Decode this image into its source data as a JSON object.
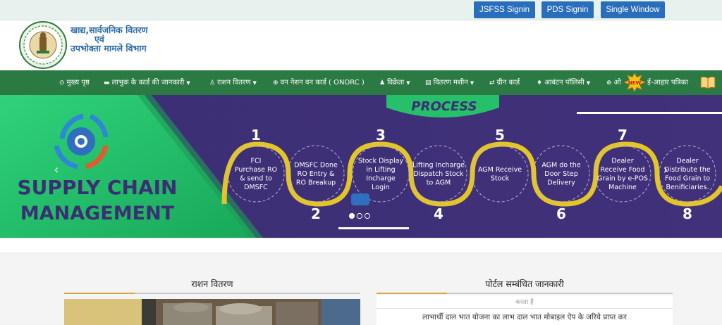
{
  "top_buttons": [
    {
      "label": "JSFSS Signin"
    },
    {
      "label": "PDS Signin"
    },
    {
      "label": "Single Window"
    }
  ],
  "header": {
    "dept_line1": "खाद्य,सार्वजनिक  वितरण",
    "dept_line2": "एवं",
    "dept_line3": "उपभोक्ता  मामले  विभाग"
  },
  "nav": {
    "items": [
      {
        "label": "मुख्य पृष्ठ",
        "icon": "home-icon",
        "dropdown": false
      },
      {
        "label": "लाभुक के कार्ड की जानकारी",
        "icon": "card-icon",
        "dropdown": true
      },
      {
        "label": "राशन वितरण",
        "icon": "user-icon",
        "dropdown": true
      },
      {
        "label": "वन नेशन वन कार्ड ( ONORC )",
        "icon": "globe-icon",
        "dropdown": false
      },
      {
        "label": "विक्रेता",
        "icon": "person-icon",
        "dropdown": true
      },
      {
        "label": "वितरण मशीन",
        "icon": "book-icon",
        "dropdown": true
      },
      {
        "label": "ग्रीन कार्ड",
        "icon": "shuffle-icon",
        "dropdown": false
      },
      {
        "label": "आबंटन पॉलिसी",
        "icon": "drop-icon",
        "dropdown": true
      },
      {
        "label": "ओ",
        "icon": "globe-icon",
        "dropdown": false
      },
      {
        "label": "ई-आहार पत्रिका",
        "icon": "book-open-icon",
        "dropdown": false
      }
    ],
    "new_badge": "NEW"
  },
  "slider": {
    "title_line1": "SUPPLY CHAIN",
    "title_line2": "MANAGEMENT",
    "banner": "PROCESS",
    "steps": [
      {
        "num": "1",
        "lines": [
          "FCI",
          "Purchase RO",
          "& send to",
          "DMSFC"
        ]
      },
      {
        "num": "2",
        "lines": [
          "DMSFC Done",
          "RO Entry &",
          "RO Breakup"
        ]
      },
      {
        "num": "3",
        "lines": [
          "Stock Display",
          "in Lifting",
          "Incharge",
          "Login"
        ]
      },
      {
        "num": "4",
        "lines": [
          "Lifting Incharge",
          "Dispatch Stock",
          "to AGM"
        ]
      },
      {
        "num": "5",
        "lines": [
          "AGM Receive",
          "Stock"
        ]
      },
      {
        "num": "6",
        "lines": [
          "AGM do the",
          "Door Step",
          "Delivery"
        ]
      },
      {
        "num": "7",
        "lines": [
          "Dealer",
          "Receive Food",
          "Grain by e-POS",
          "Machine"
        ]
      },
      {
        "num": "8",
        "lines": [
          "Dealer",
          "Distribute the",
          "Food Grain to",
          "Benificiaries."
        ]
      }
    ],
    "dots_count": 3,
    "active_dot": 1,
    "prev_icon": "chevron-left-icon",
    "next_icon": "chevron-right-icon"
  },
  "panels": {
    "left_title": "राशन वितरण",
    "right_title": "पोर्टल सम्बंधित जानकारी",
    "right_faded": "करता है",
    "right_line": "लाभार्थी दाल भात योजना का लाभ दाल भात मोबाइल ऐप के जरिये प्राप्त कर"
  },
  "colors": {
    "nav_green": "#2c7a43",
    "button_blue": "#2a6ebb",
    "slider_purple": "#3d2f76",
    "slider_green": "#27c06a",
    "path_yellow": "#e3c52a"
  }
}
